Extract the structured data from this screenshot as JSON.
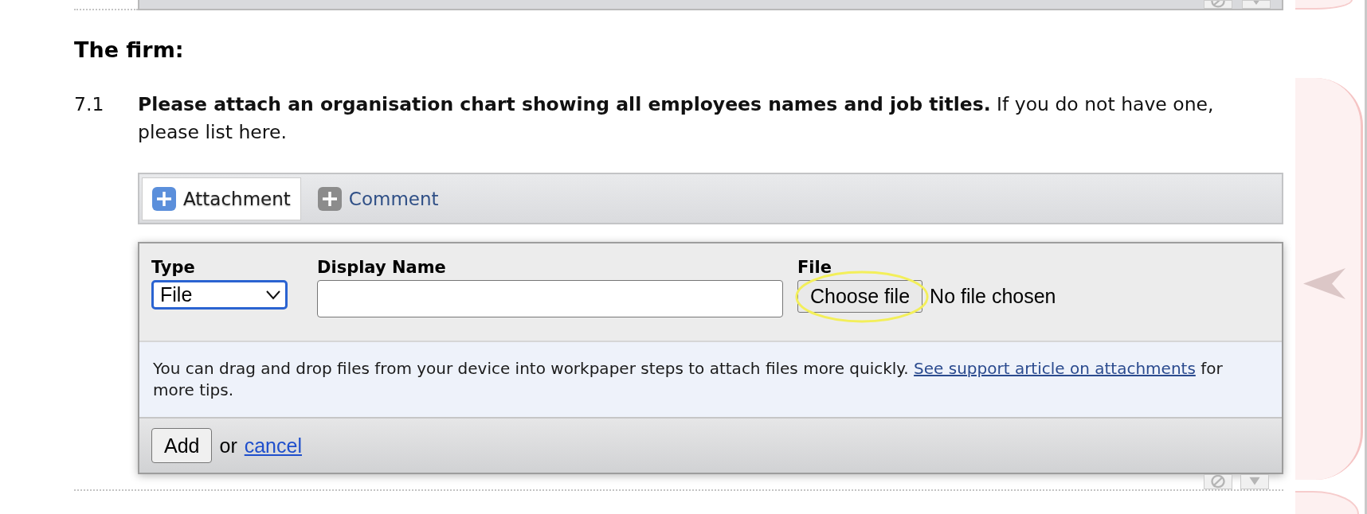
{
  "section": {
    "heading": "The firm:"
  },
  "question": {
    "number": "7.1",
    "text": "**Please attach an organisation chart showing all employees names and job titles.** If you do not have one, please list here."
  },
  "tabs": [
    {
      "label": "Attachment",
      "selected": true
    },
    {
      "label": "Comment",
      "selected": false
    }
  ],
  "attachment_form": {
    "fields": [
      {
        "kind": "select",
        "label": "Type",
        "value": "File",
        "focused": true
      },
      {
        "kind": "text",
        "label": "Display Name",
        "focused": false
      },
      {
        "kind": "file",
        "label": "File",
        "button": "Choose file",
        "status": "No file chosen",
        "circled": true
      }
    ],
    "hint": {
      "text": "You can drag and drop files from your device into workpaper steps to attach files more quickly.",
      "link": "See support article on attachments",
      "after": "for more tips."
    },
    "actions": {
      "button": "Add",
      "separator": "or",
      "link": "cancel"
    }
  }
}
